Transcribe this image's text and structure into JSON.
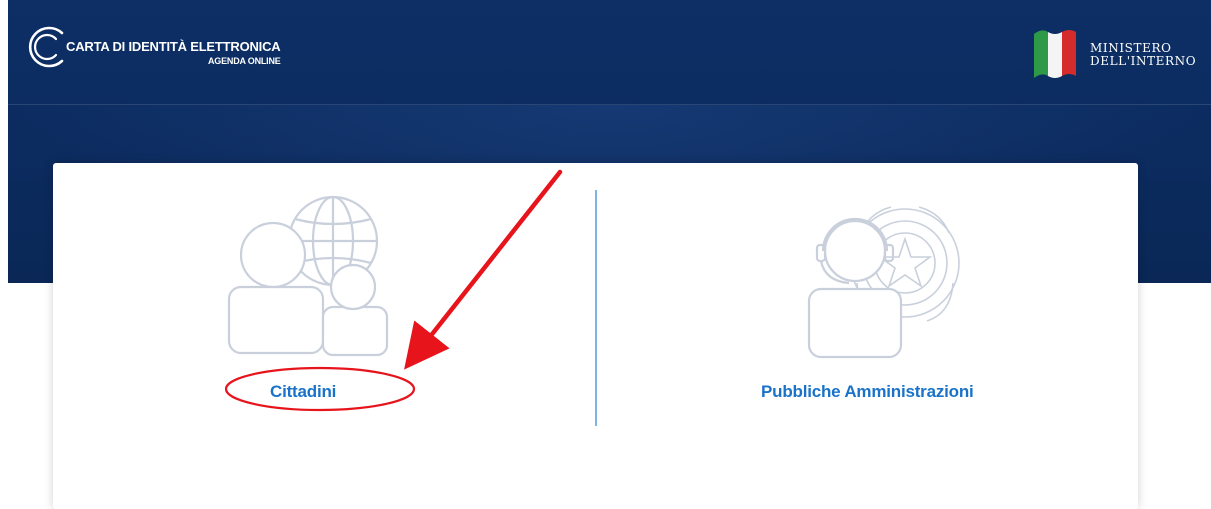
{
  "header": {
    "brand_title": "CARTA DI IDENTITÀ ELETTRONICA",
    "brand_subtitle": "AGENDA ONLINE",
    "ministry_line1": "MINISTERO",
    "ministry_line2": "DELL'INTERNO"
  },
  "options": [
    {
      "label": "Cittadini",
      "icon": "citizens-globe-icon"
    },
    {
      "label": "Pubbliche Amministrazioni",
      "icon": "operator-emblem-icon"
    }
  ],
  "colors": {
    "header_bg": "#0c2c60",
    "link": "#1a73c9",
    "divider": "#7fb3e6",
    "annotation": "#e8141c",
    "icon_line": "#c9d0dc"
  }
}
